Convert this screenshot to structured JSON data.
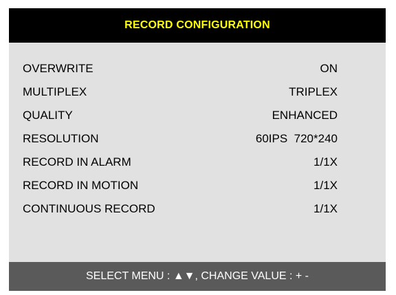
{
  "title": "RECORD CONFIGURATION",
  "colors": {
    "title_bg": "#000000",
    "title_text": "#ffff00",
    "panel_bg": "#e1e1e1",
    "footer_bg": "#5a5a5a"
  },
  "settings": [
    {
      "label": "OVERWRITE",
      "value": "ON"
    },
    {
      "label": "MULTIPLEX",
      "value": "TRIPLEX"
    },
    {
      "label": "QUALITY",
      "value": "ENHANCED"
    },
    {
      "label": "RESOLUTION",
      "value": "60IPS  720*240"
    },
    {
      "label": "RECORD IN ALARM",
      "value": "1/1X"
    },
    {
      "label": "RECORD IN MOTION",
      "value": "1/1X"
    },
    {
      "label": "CONTINUOUS RECORD",
      "value": "1/1X"
    }
  ],
  "footer": "SELECT MENU : ▲▼, CHANGE VALUE : + -"
}
